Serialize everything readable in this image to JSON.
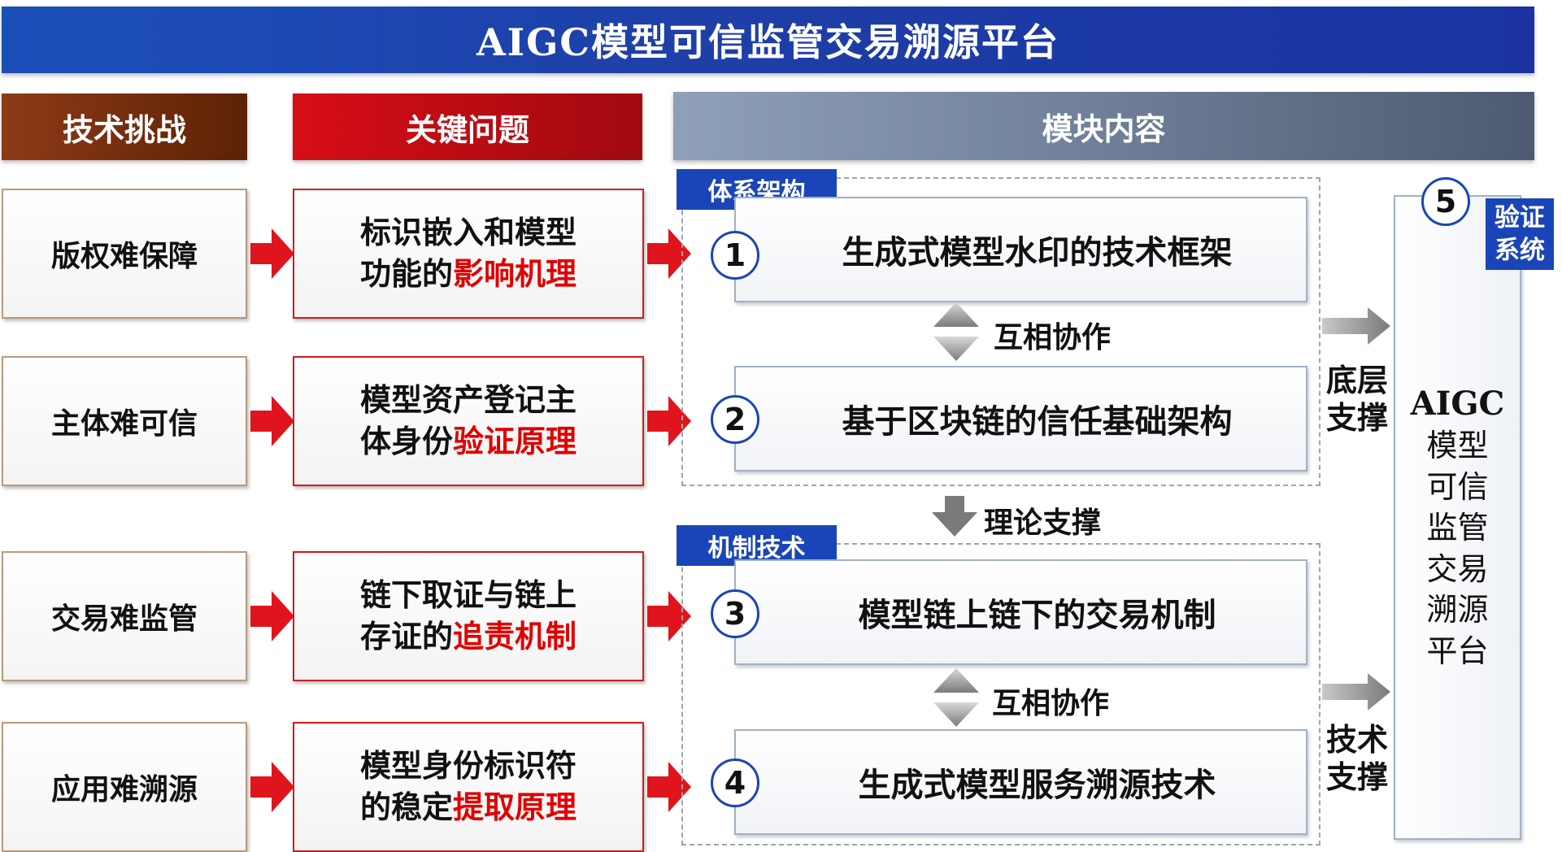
{
  "title": "AIGC模型可信监管交易溯源平台",
  "headers": {
    "challenge": "技术挑战",
    "issue": "关键问题",
    "module": "模块内容"
  },
  "challenges": [
    "版权难保障",
    "主体难可信",
    "交易难监管",
    "应用难溯源"
  ],
  "issues": [
    {
      "line1": "标识嵌入和模型",
      "line2_plain": "功能的",
      "line2_highlight": "影响机理"
    },
    {
      "line1": "模型资产登记主",
      "line2_plain": "体身份",
      "line2_highlight": "验证原理"
    },
    {
      "line1": "链下取证与链上",
      "line2_plain": "存证的",
      "line2_highlight": "追责机制"
    },
    {
      "line1": "模型身份标识符",
      "line2_plain": "的稳定",
      "line2_highlight": "提取原理"
    }
  ],
  "sections": {
    "architecture": "体系架构",
    "mechanism": "机制技术"
  },
  "modules": [
    {
      "number": "1",
      "label": "生成式模型水印的技术框架"
    },
    {
      "number": "2",
      "label": "基于区块链的信任基础架构"
    },
    {
      "number": "3",
      "label": "模型链上链下的交易机制"
    },
    {
      "number": "4",
      "label": "生成式模型服务溯源技术"
    }
  ],
  "connectors": {
    "collab_1": "互相协作",
    "theory": "理论支撑",
    "collab_2": "互相协作"
  },
  "side_labels": {
    "base_support": [
      "底层",
      "支撑"
    ],
    "tech_support": [
      "技术",
      "支撑"
    ]
  },
  "platform": {
    "number": "5",
    "verify_tag": [
      "验证",
      "系统"
    ],
    "latin": "AIGC",
    "lines": [
      "模型",
      "可信",
      "监管",
      "交易",
      "溯源",
      "平台"
    ]
  },
  "colors": {
    "title_blue": "#1e3fa8",
    "challenge_brown": "#7a2e0e",
    "issue_red": "#c00b12",
    "module_gray": "#6f7f98",
    "highlight_red": "#e00000",
    "arrow_red": "#e0141c",
    "arrow_gray": "#7a7a7a"
  }
}
